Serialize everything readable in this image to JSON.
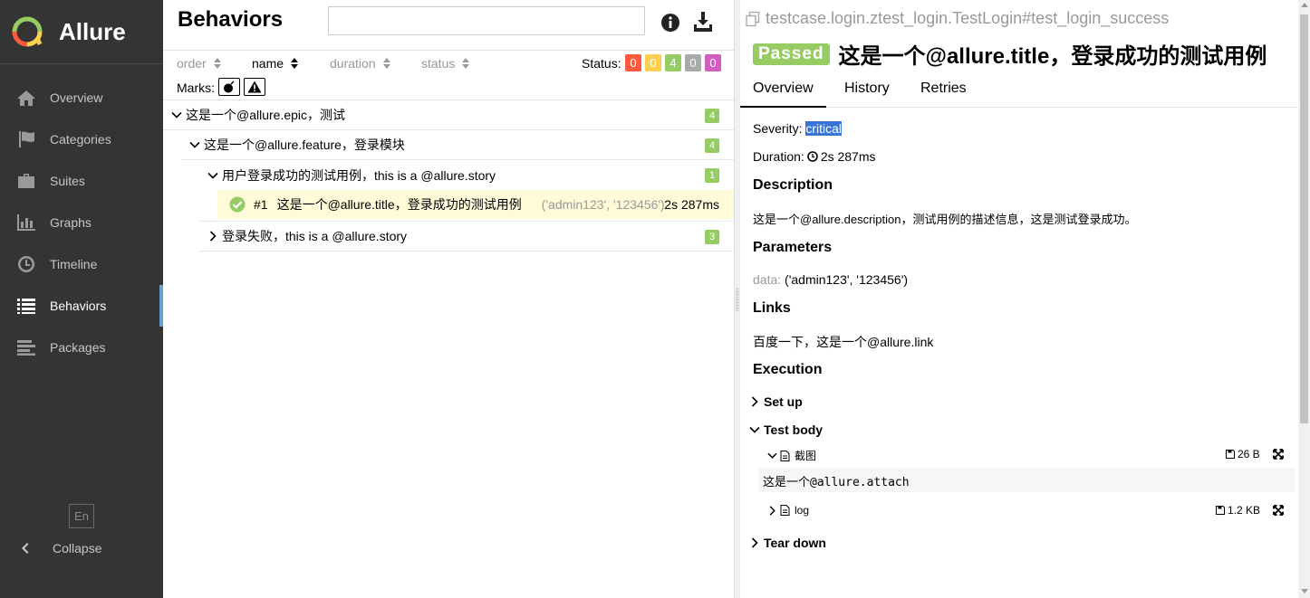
{
  "app": {
    "name": "Allure"
  },
  "colors": {
    "sidebar_bg": "#343434",
    "accent": "#6a9fd2",
    "passed": "#97cc64",
    "failed": "#fd5a3e",
    "broken": "#ffd050",
    "skipped": "#aaaaaa",
    "unknown": "#d35ebe",
    "selected_row": "#fffbd9"
  },
  "sidebar": {
    "items": [
      {
        "label": "Overview",
        "icon": "home-icon"
      },
      {
        "label": "Categories",
        "icon": "flag-icon"
      },
      {
        "label": "Suites",
        "icon": "briefcase-icon"
      },
      {
        "label": "Graphs",
        "icon": "bar-chart-icon"
      },
      {
        "label": "Timeline",
        "icon": "clock-icon"
      },
      {
        "label": "Behaviors",
        "icon": "list-icon",
        "active": true
      },
      {
        "label": "Packages",
        "icon": "align-left-icon"
      }
    ],
    "language": "En",
    "collapse_label": "Collapse"
  },
  "behaviors": {
    "title": "Behaviors",
    "search": {
      "value": "",
      "placeholder": ""
    },
    "sort": [
      {
        "label": "order",
        "active": false
      },
      {
        "label": "name",
        "active": true
      },
      {
        "label": "duration",
        "active": false
      },
      {
        "label": "status",
        "active": false
      }
    ],
    "status_label": "Status:",
    "status_counts": [
      {
        "name": "failed",
        "count": "0",
        "color": "#fd5a3e"
      },
      {
        "name": "broken",
        "count": "0",
        "color": "#ffd050"
      },
      {
        "name": "passed",
        "count": "4",
        "color": "#97cc64"
      },
      {
        "name": "skipped",
        "count": "0",
        "color": "#aaaaaa"
      },
      {
        "name": "unknown",
        "count": "0",
        "color": "#d35ebe"
      }
    ],
    "marks_label": "Marks:",
    "tree": {
      "epic": {
        "label": "这是一个@allure.epic，测试",
        "count": "4"
      },
      "feature": {
        "label": "这是一个@allure.feature，登录模块",
        "count": "4"
      },
      "story1": {
        "label": "用户登录成功的测试用例，this is a @allure.story",
        "count": "1"
      },
      "case": {
        "num": "#1",
        "name": "这是一个@allure.title，登录成功的测试用例",
        "params": "('admin123', '123456')",
        "duration": "2s 287ms"
      },
      "story2": {
        "label": "登录失败，this is a @allure.story",
        "count": "3"
      }
    }
  },
  "testcase": {
    "full_name": "testcase.login.ztest_login.TestLogin#test_login_success",
    "status": "Passed",
    "title": "这是一个@allure.title，登录成功的测试用例",
    "tabs": [
      "Overview",
      "History",
      "Retries"
    ],
    "severity_label": "Severity:",
    "severity": "critical",
    "duration_label": "Duration:",
    "duration": "2s 287ms",
    "description_heading": "Description",
    "description": "这是一个@allure.description，测试用例的描述信息，这是测试登录成功。",
    "parameters_heading": "Parameters",
    "param_name": "data",
    "param_value": "('admin123', '123456')",
    "links_heading": "Links",
    "link": "百度一下，这是一个@allure.link",
    "execution_heading": "Execution",
    "setup": "Set up",
    "test_body": "Test body",
    "attachments": [
      {
        "name": "截图",
        "size": "26 B",
        "content": "这是一个@allure.attach"
      },
      {
        "name": "log",
        "size": "1.2 KB"
      }
    ],
    "teardown": "Tear down"
  }
}
